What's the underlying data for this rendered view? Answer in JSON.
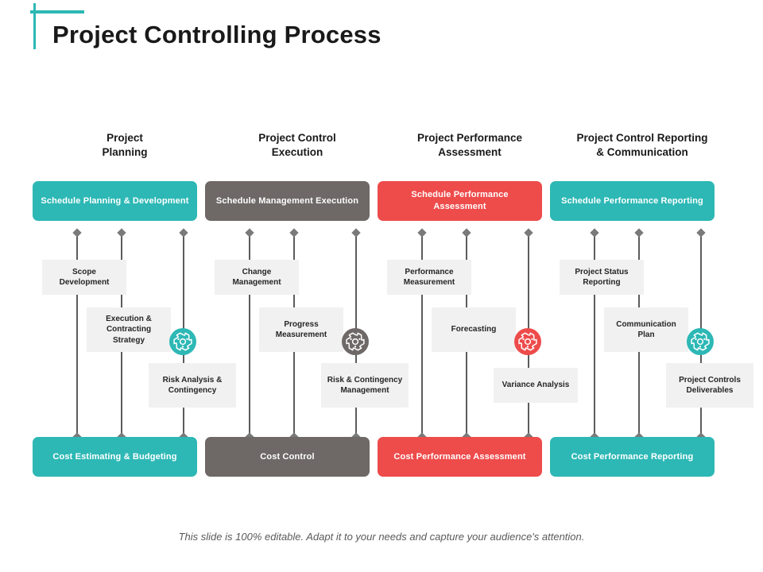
{
  "slide": {
    "title": "Project Controlling Process",
    "footer_note": "This slide is 100% editable. Adapt it to your needs and capture your audience's attention."
  },
  "colors": {
    "teal": "#2DB8B5",
    "gray": "#6E6866",
    "red": "#EE4B4B",
    "node_bg": "#F1F1F1",
    "rail": "#5C5C5C",
    "diamond": "#7A7A7A",
    "title": "#191919",
    "footer": "#5A5A5A"
  },
  "columns": [
    {
      "header": "Project\nPlanning",
      "header_line1": "Project",
      "header_line2": "Planning",
      "accent": "#2DB8B5",
      "top_box": "Schedule Planning & Development",
      "bottom_box": "Cost Estimating  & Budgeting",
      "nodes": [
        "Scope Development",
        "Execution & Contracting Strategy",
        "Risk Analysis & Contingency"
      ],
      "gear_icon": "gear-icon"
    },
    {
      "header": "Project Control\nExecution",
      "header_line1": "Project Control",
      "header_line2": "Execution",
      "accent": "#6E6866",
      "top_box": "Schedule Management Execution",
      "bottom_box": "Cost Control",
      "nodes": [
        "Change Management",
        "Progress Measurement",
        "Risk & Contingency Management"
      ],
      "gear_icon": "gear-icon"
    },
    {
      "header": "Project Performance\nAssessment",
      "header_line1": "Project Performance",
      "header_line2": "Assessment",
      "accent": "#EE4B4B",
      "top_box": "Schedule Performance Assessment",
      "bottom_box": "Cost Performance Assessment",
      "nodes": [
        "Performance Measurement",
        "Forecasting",
        "Variance Analysis"
      ],
      "gear_icon": "gear-icon"
    },
    {
      "header": "Project Control Reporting\n& Communication",
      "header_line1": "Project Control Reporting",
      "header_line2": "& Communication",
      "accent": "#2DB8B5",
      "top_box": "Schedule Performance Reporting",
      "bottom_box": "Cost Performance  Reporting",
      "nodes": [
        "Project Status Reporting",
        "Communication Plan",
        "Project Controls Deliverables"
      ],
      "gear_icon": "gear-icon"
    }
  ]
}
